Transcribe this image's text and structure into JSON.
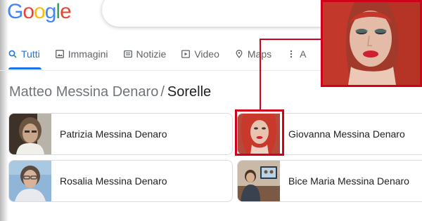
{
  "logo": {
    "letters": [
      "G",
      "o",
      "o",
      "g",
      "l",
      "e"
    ]
  },
  "tabs": [
    {
      "label": "Tutti",
      "icon": "search-icon",
      "active": true
    },
    {
      "label": "Immagini",
      "icon": "image-icon",
      "active": false
    },
    {
      "label": "Notizie",
      "icon": "news-icon",
      "active": false
    },
    {
      "label": "Video",
      "icon": "play-icon",
      "active": false
    },
    {
      "label": "Maps",
      "icon": "map-pin-icon",
      "active": false
    },
    {
      "label": "A",
      "icon": "more-vert-icon",
      "active": false
    }
  ],
  "breadcrumb": {
    "parent": "Matteo Messina Denaro",
    "separator": "/",
    "current": "Sorelle"
  },
  "people": [
    {
      "name": "Patrizia Messina Denaro"
    },
    {
      "name": "Giovanna Messina Denaro"
    },
    {
      "name": "Rosalia Messina Denaro"
    },
    {
      "name": "Bice Maria Messina Denaro"
    }
  ],
  "colors": {
    "accent": "#1a73e8",
    "highlight": "#d0021b"
  }
}
